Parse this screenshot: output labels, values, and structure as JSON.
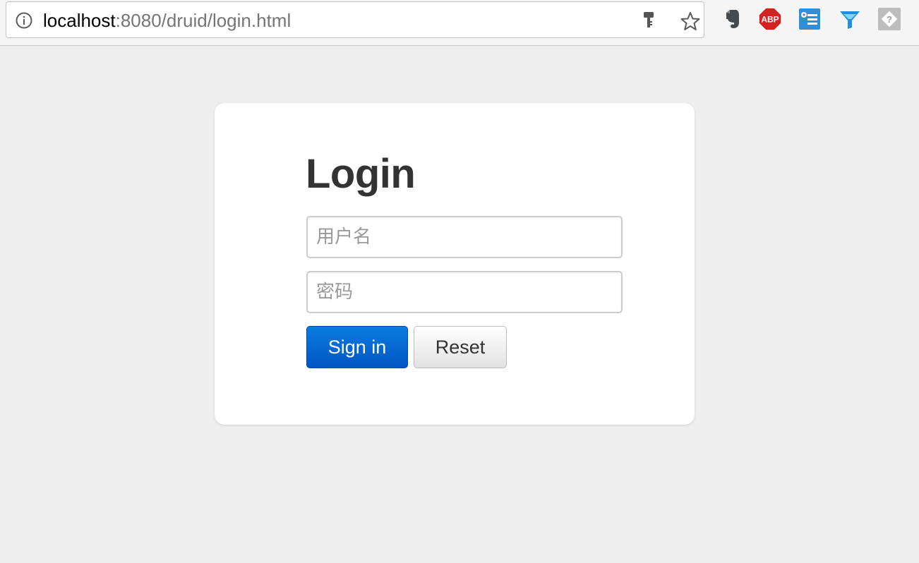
{
  "browser": {
    "url_host": "localhost",
    "url_rest": ":8080/druid/login.html",
    "icons": {
      "info": "info-icon",
      "key": "key-icon",
      "bookmark": "star-icon"
    },
    "extensions": [
      {
        "name": "evernote-icon"
      },
      {
        "name": "adblock-plus-icon",
        "label": "ABP"
      },
      {
        "name": "tab-manager-icon"
      },
      {
        "name": "funnel-icon"
      },
      {
        "name": "unknown-extension-icon",
        "label": "?"
      }
    ]
  },
  "login": {
    "title": "Login",
    "username_placeholder": "用户名",
    "password_placeholder": "密码",
    "signin_label": "Sign in",
    "reset_label": "Reset"
  },
  "colors": {
    "page_bg": "#eeeeee",
    "card_bg": "#ffffff",
    "title": "#333333",
    "primary": "#0066cc",
    "abp_red": "#d22222",
    "evernote": "#444b50"
  }
}
